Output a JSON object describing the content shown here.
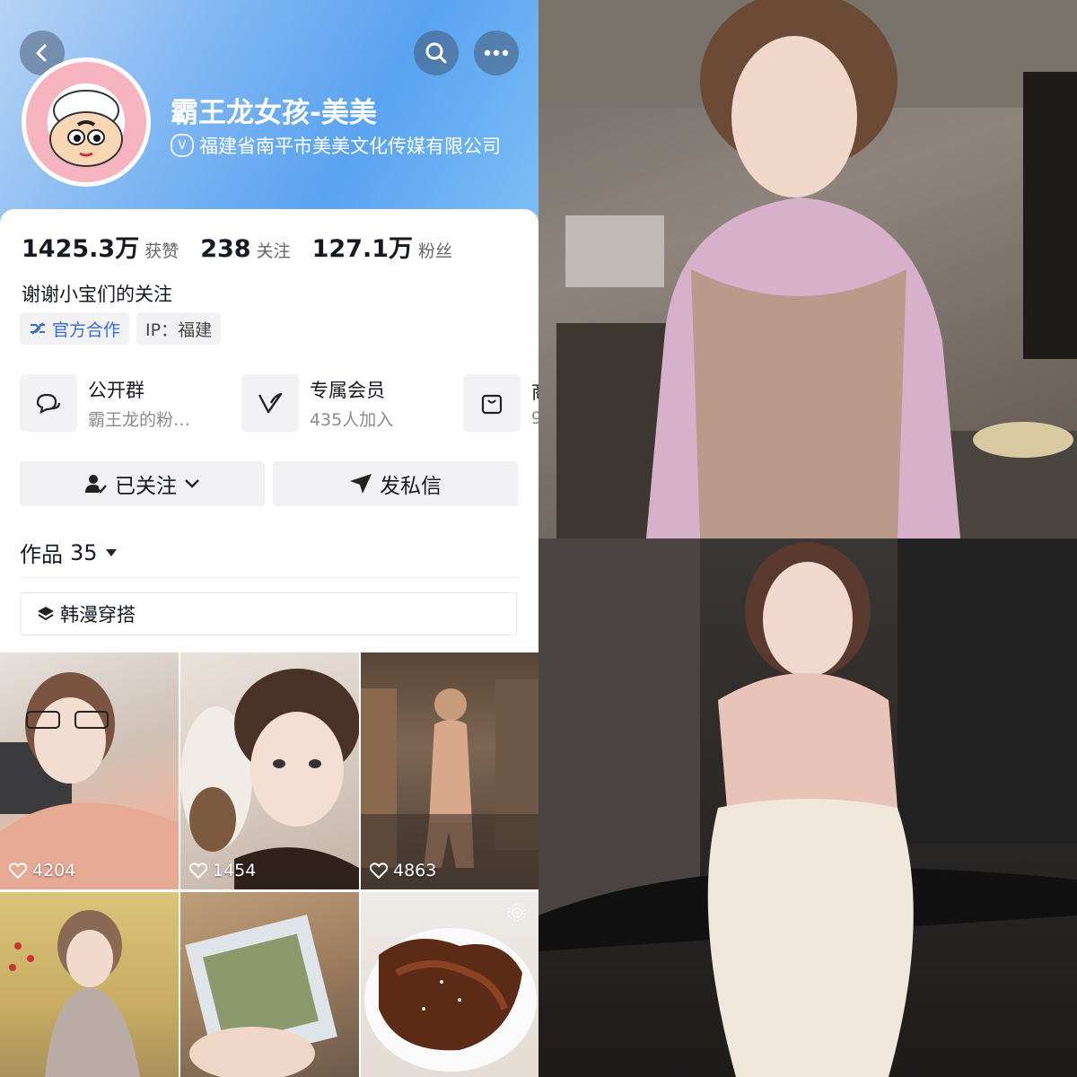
{
  "profile": {
    "name": "霸王龙女孩-美美",
    "verified_org": "福建省南平市美美文化传媒有限公司",
    "verified_mark": "V"
  },
  "stats": [
    {
      "value": "1425.3万",
      "label": "获赞"
    },
    {
      "value": "238",
      "label": "关注"
    },
    {
      "value": "127.1万",
      "label": "粉丝"
    }
  ],
  "bio": "谢谢小宝们的关注",
  "tags": {
    "official": "官方合作",
    "ip": "IP：福建"
  },
  "features": [
    {
      "title": "公开群",
      "sub": "霸王龙的粉…",
      "icon": "chat-group-icon"
    },
    {
      "title": "专属会员",
      "sub": "435人加入",
      "icon": "member-v-icon"
    },
    {
      "title": "商",
      "sub": "9",
      "icon": "shop-bag-icon"
    }
  ],
  "actions": {
    "follow": "已关注",
    "message": "发私信"
  },
  "works": {
    "label": "作品",
    "count": "35"
  },
  "collection": "韩漫穿搭",
  "videos": [
    {
      "likes": "4204"
    },
    {
      "likes": "1454"
    },
    {
      "likes": "4863"
    },
    {
      "likes": ""
    },
    {
      "likes": ""
    },
    {
      "likes": ""
    }
  ],
  "colors": {
    "header_gradient": "#5aa3f0",
    "tag_blue": "#3a6bd8",
    "text": "#161823"
  }
}
